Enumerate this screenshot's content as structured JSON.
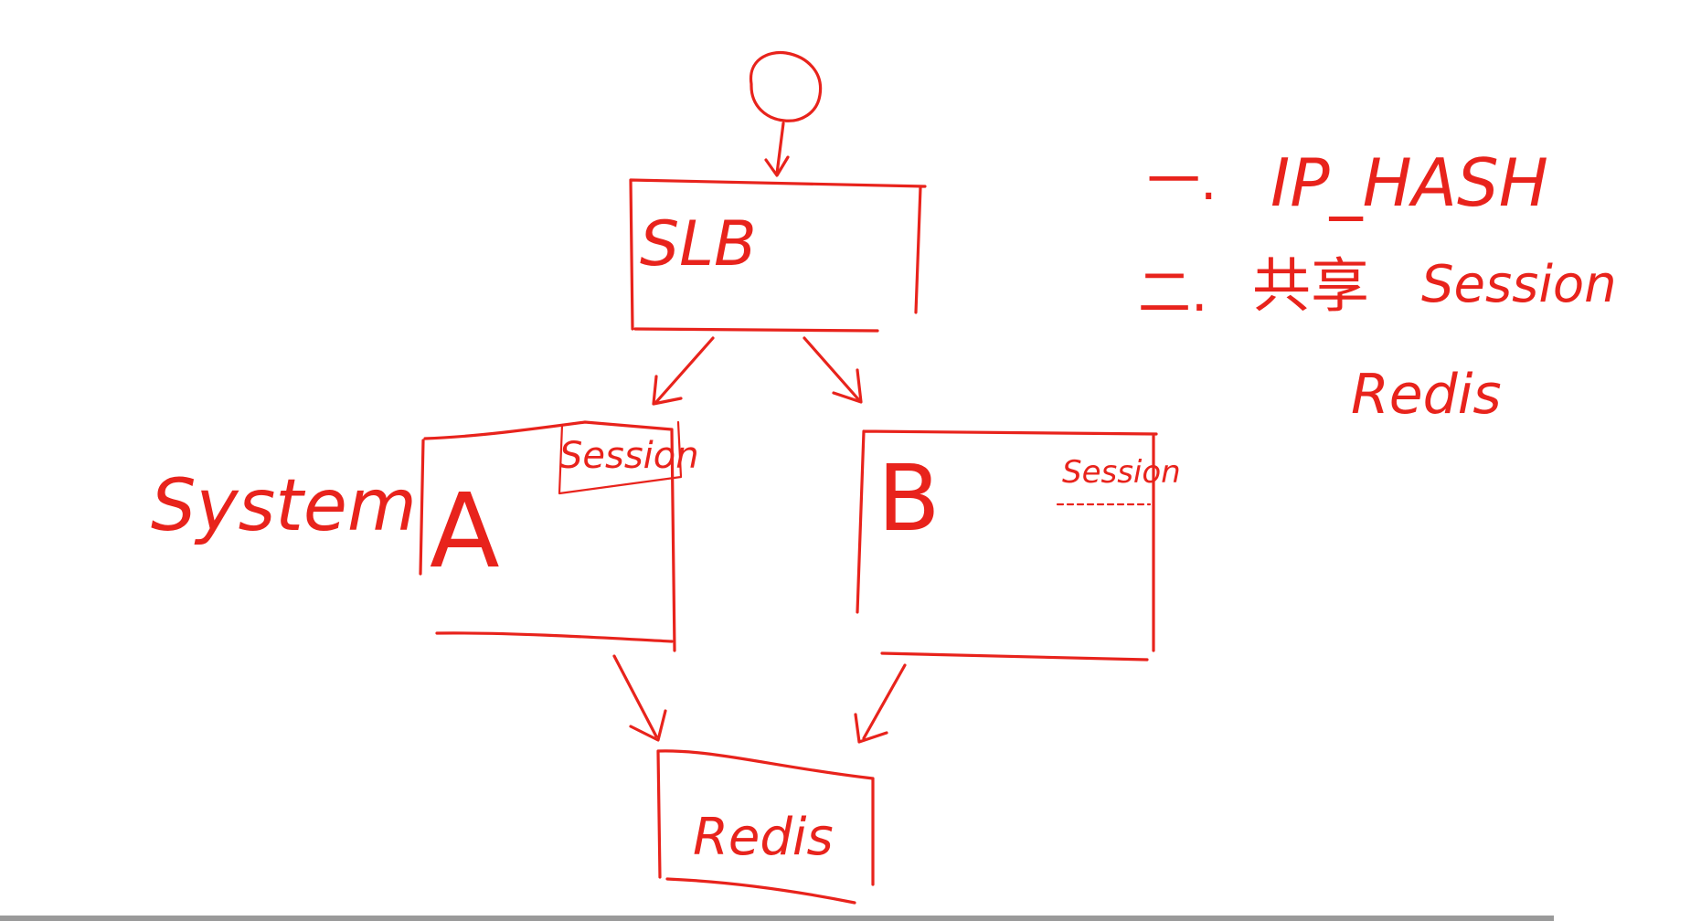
{
  "colors": {
    "ink": "#e8231c",
    "background": "#ffffff",
    "scrollbar": "#9a9a9a"
  },
  "diagram": {
    "nodes": {
      "client": {
        "shape": "circle"
      },
      "slb": {
        "label": "SLB"
      },
      "server_a": {
        "label": "A",
        "session_label": "Session"
      },
      "server_b": {
        "label": "B",
        "session_label": "Session"
      },
      "redis_store": {
        "label": "Redis"
      }
    },
    "annotations": {
      "system_label": "System"
    },
    "edges": [
      {
        "from": "client",
        "to": "slb"
      },
      {
        "from": "slb",
        "to": "server_a"
      },
      {
        "from": "slb",
        "to": "server_b"
      },
      {
        "from": "server_a",
        "to": "redis_store"
      },
      {
        "from": "server_b",
        "to": "redis_store"
      }
    ]
  },
  "notes": {
    "item1": {
      "marker": "一.",
      "text": "IP_HASH"
    },
    "item2": {
      "marker": "二.",
      "text_cn": "共享",
      "text_en": "Session"
    },
    "item2_sub": "Redis"
  }
}
